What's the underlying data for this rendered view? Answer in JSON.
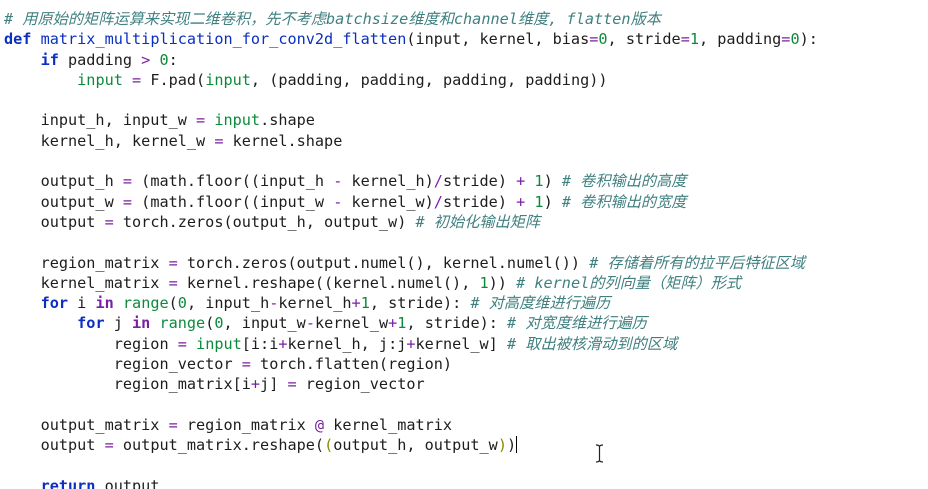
{
  "code_lines": [
    [
      {
        "t": "c",
        "v": "# 用原始的矩阵运算来实现二维卷积，先不考虑batchsize维度和channel维度, flatten版本"
      }
    ],
    [
      {
        "t": "k",
        "v": "def"
      },
      {
        "t": "n",
        "v": " "
      },
      {
        "t": "fn",
        "v": "matrix_multiplication_for_conv2d_flatten"
      },
      {
        "t": "n",
        "v": "(input, kernel, bias"
      },
      {
        "t": "o",
        "v": "="
      },
      {
        "t": "num",
        "v": "0"
      },
      {
        "t": "n",
        "v": ", stride"
      },
      {
        "t": "o",
        "v": "="
      },
      {
        "t": "num",
        "v": "1"
      },
      {
        "t": "n",
        "v": ", padding"
      },
      {
        "t": "o",
        "v": "="
      },
      {
        "t": "num",
        "v": "0"
      },
      {
        "t": "n",
        "v": "):"
      }
    ],
    [
      {
        "t": "n",
        "v": "    "
      },
      {
        "t": "k",
        "v": "if"
      },
      {
        "t": "n",
        "v": " padding "
      },
      {
        "t": "o",
        "v": ">"
      },
      {
        "t": "n",
        "v": " "
      },
      {
        "t": "num",
        "v": "0"
      },
      {
        "t": "n",
        "v": ":"
      }
    ],
    [
      {
        "t": "n",
        "v": "        "
      },
      {
        "t": "bi",
        "v": "input"
      },
      {
        "t": "n",
        "v": " "
      },
      {
        "t": "o",
        "v": "="
      },
      {
        "t": "n",
        "v": " F.pad("
      },
      {
        "t": "bi",
        "v": "input"
      },
      {
        "t": "n",
        "v": ", (padding, padding, padding, padding))"
      }
    ],
    [
      {
        "t": "n",
        "v": ""
      }
    ],
    [
      {
        "t": "n",
        "v": "    input_h, input_w "
      },
      {
        "t": "o",
        "v": "="
      },
      {
        "t": "n",
        "v": " "
      },
      {
        "t": "bi",
        "v": "input"
      },
      {
        "t": "n",
        "v": ".shape"
      }
    ],
    [
      {
        "t": "n",
        "v": "    kernel_h, kernel_w "
      },
      {
        "t": "o",
        "v": "="
      },
      {
        "t": "n",
        "v": " kernel.shape"
      }
    ],
    [
      {
        "t": "n",
        "v": ""
      }
    ],
    [
      {
        "t": "n",
        "v": "    output_h "
      },
      {
        "t": "o",
        "v": "="
      },
      {
        "t": "n",
        "v": " (math.floor((input_h "
      },
      {
        "t": "o",
        "v": "-"
      },
      {
        "t": "n",
        "v": " kernel_h)"
      },
      {
        "t": "o",
        "v": "/"
      },
      {
        "t": "n",
        "v": "stride) "
      },
      {
        "t": "o",
        "v": "+"
      },
      {
        "t": "n",
        "v": " "
      },
      {
        "t": "num",
        "v": "1"
      },
      {
        "t": "n",
        "v": ") "
      },
      {
        "t": "c",
        "v": "# 卷积输出的高度"
      }
    ],
    [
      {
        "t": "n",
        "v": "    output_w "
      },
      {
        "t": "o",
        "v": "="
      },
      {
        "t": "n",
        "v": " (math.floor((input_w "
      },
      {
        "t": "o",
        "v": "-"
      },
      {
        "t": "n",
        "v": " kernel_w)"
      },
      {
        "t": "o",
        "v": "/"
      },
      {
        "t": "n",
        "v": "stride) "
      },
      {
        "t": "o",
        "v": "+"
      },
      {
        "t": "n",
        "v": " "
      },
      {
        "t": "num",
        "v": "1"
      },
      {
        "t": "n",
        "v": ") "
      },
      {
        "t": "c",
        "v": "# 卷积输出的宽度"
      }
    ],
    [
      {
        "t": "n",
        "v": "    output "
      },
      {
        "t": "o",
        "v": "="
      },
      {
        "t": "n",
        "v": " torch.zeros(output_h, output_w) "
      },
      {
        "t": "c",
        "v": "# 初始化输出矩阵"
      }
    ],
    [
      {
        "t": "n",
        "v": ""
      }
    ],
    [
      {
        "t": "n",
        "v": "    region_matrix "
      },
      {
        "t": "o",
        "v": "="
      },
      {
        "t": "n",
        "v": " torch.zeros(output.numel(), kernel.numel()) "
      },
      {
        "t": "c",
        "v": "# 存储着所有的拉平后特征区域"
      }
    ],
    [
      {
        "t": "n",
        "v": "    kernel_matrix "
      },
      {
        "t": "o",
        "v": "="
      },
      {
        "t": "n",
        "v": " kernel.reshape((kernel.numel(), "
      },
      {
        "t": "num",
        "v": "1"
      },
      {
        "t": "n",
        "v": ")) "
      },
      {
        "t": "c",
        "v": "# kernel的列向量（矩阵）形式"
      }
    ],
    [
      {
        "t": "n",
        "v": "    "
      },
      {
        "t": "k",
        "v": "for"
      },
      {
        "t": "n",
        "v": " i "
      },
      {
        "t": "kw",
        "v": "in"
      },
      {
        "t": "n",
        "v": " "
      },
      {
        "t": "bi",
        "v": "range"
      },
      {
        "t": "n",
        "v": "("
      },
      {
        "t": "num",
        "v": "0"
      },
      {
        "t": "n",
        "v": ", input_h"
      },
      {
        "t": "o",
        "v": "-"
      },
      {
        "t": "n",
        "v": "kernel_h"
      },
      {
        "t": "o",
        "v": "+"
      },
      {
        "t": "num",
        "v": "1"
      },
      {
        "t": "n",
        "v": ", stride): "
      },
      {
        "t": "c",
        "v": "# 对高度维进行遍历"
      }
    ],
    [
      {
        "t": "n",
        "v": "        "
      },
      {
        "t": "k",
        "v": "for"
      },
      {
        "t": "n",
        "v": " j "
      },
      {
        "t": "kw",
        "v": "in"
      },
      {
        "t": "n",
        "v": " "
      },
      {
        "t": "bi",
        "v": "range"
      },
      {
        "t": "n",
        "v": "("
      },
      {
        "t": "num",
        "v": "0"
      },
      {
        "t": "n",
        "v": ", input_w"
      },
      {
        "t": "o",
        "v": "-"
      },
      {
        "t": "n",
        "v": "kernel_w"
      },
      {
        "t": "o",
        "v": "+"
      },
      {
        "t": "num",
        "v": "1"
      },
      {
        "t": "n",
        "v": ", stride): "
      },
      {
        "t": "c",
        "v": "# 对宽度维进行遍历"
      }
    ],
    [
      {
        "t": "n",
        "v": "            region "
      },
      {
        "t": "o",
        "v": "="
      },
      {
        "t": "n",
        "v": " "
      },
      {
        "t": "bi",
        "v": "input"
      },
      {
        "t": "n",
        "v": "[i:i"
      },
      {
        "t": "o",
        "v": "+"
      },
      {
        "t": "n",
        "v": "kernel_h, j:j"
      },
      {
        "t": "o",
        "v": "+"
      },
      {
        "t": "n",
        "v": "kernel_w] "
      },
      {
        "t": "c",
        "v": "# 取出被核滑动到的区域"
      }
    ],
    [
      {
        "t": "n",
        "v": "            region_vector "
      },
      {
        "t": "o",
        "v": "="
      },
      {
        "t": "n",
        "v": " torch.flatten(region)"
      }
    ],
    [
      {
        "t": "n",
        "v": "            region_matrix[i"
      },
      {
        "t": "o",
        "v": "+"
      },
      {
        "t": "n",
        "v": "j] "
      },
      {
        "t": "o",
        "v": "="
      },
      {
        "t": "n",
        "v": " region_vector"
      }
    ],
    [
      {
        "t": "n",
        "v": ""
      }
    ],
    [
      {
        "t": "n",
        "v": "    output_matrix "
      },
      {
        "t": "o",
        "v": "="
      },
      {
        "t": "n",
        "v": " region_matrix "
      },
      {
        "t": "o",
        "v": "@"
      },
      {
        "t": "n",
        "v": " kernel_matrix"
      }
    ],
    [
      {
        "t": "n",
        "v": "    output "
      },
      {
        "t": "o",
        "v": "="
      },
      {
        "t": "n",
        "v": " output_matrix.reshape("
      },
      {
        "t": "bm",
        "v": "("
      },
      {
        "t": "n",
        "v": "output_h, output_w"
      },
      {
        "t": "bm",
        "v": ")"
      },
      {
        "t": "n",
        "v": ")"
      },
      {
        "t": "cursor",
        "v": ""
      }
    ],
    [
      {
        "t": "n",
        "v": ""
      }
    ],
    [
      {
        "t": "n",
        "v": "    "
      },
      {
        "t": "k",
        "v": "return"
      },
      {
        "t": "n",
        "v": " output"
      }
    ]
  ],
  "colors": {
    "background": "#ffffff",
    "comment": "#408080",
    "keyword": "#0b2fbf",
    "function_name": "#0b2fbf",
    "operator": "#7a1fa2",
    "number": "#0c8a3c",
    "builtin": "#0c8a3c"
  },
  "icons": {
    "mouse_pointer": "text-ibeam-icon"
  }
}
